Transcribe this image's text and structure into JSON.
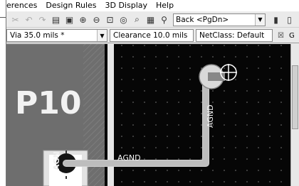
{
  "menubar": {
    "items": [
      "erences",
      "Design Rules",
      "3D Display",
      "Help"
    ]
  },
  "toolbar": {
    "nav_value": "Back  <PgDn>"
  },
  "propbar": {
    "via": "Via 35.0 mils *",
    "clearance": "Clearance 10.0 mils",
    "netclass": "NetClass: Default"
  },
  "canvas": {
    "component_label": "P10",
    "net_vertical": "AGND",
    "net_horizontal": "AGND",
    "pad_label": "AGN"
  },
  "colors": {
    "canvas_bg": "#060606",
    "trace": "#e6e6e6",
    "grid_dot": "#7a7a7a"
  }
}
